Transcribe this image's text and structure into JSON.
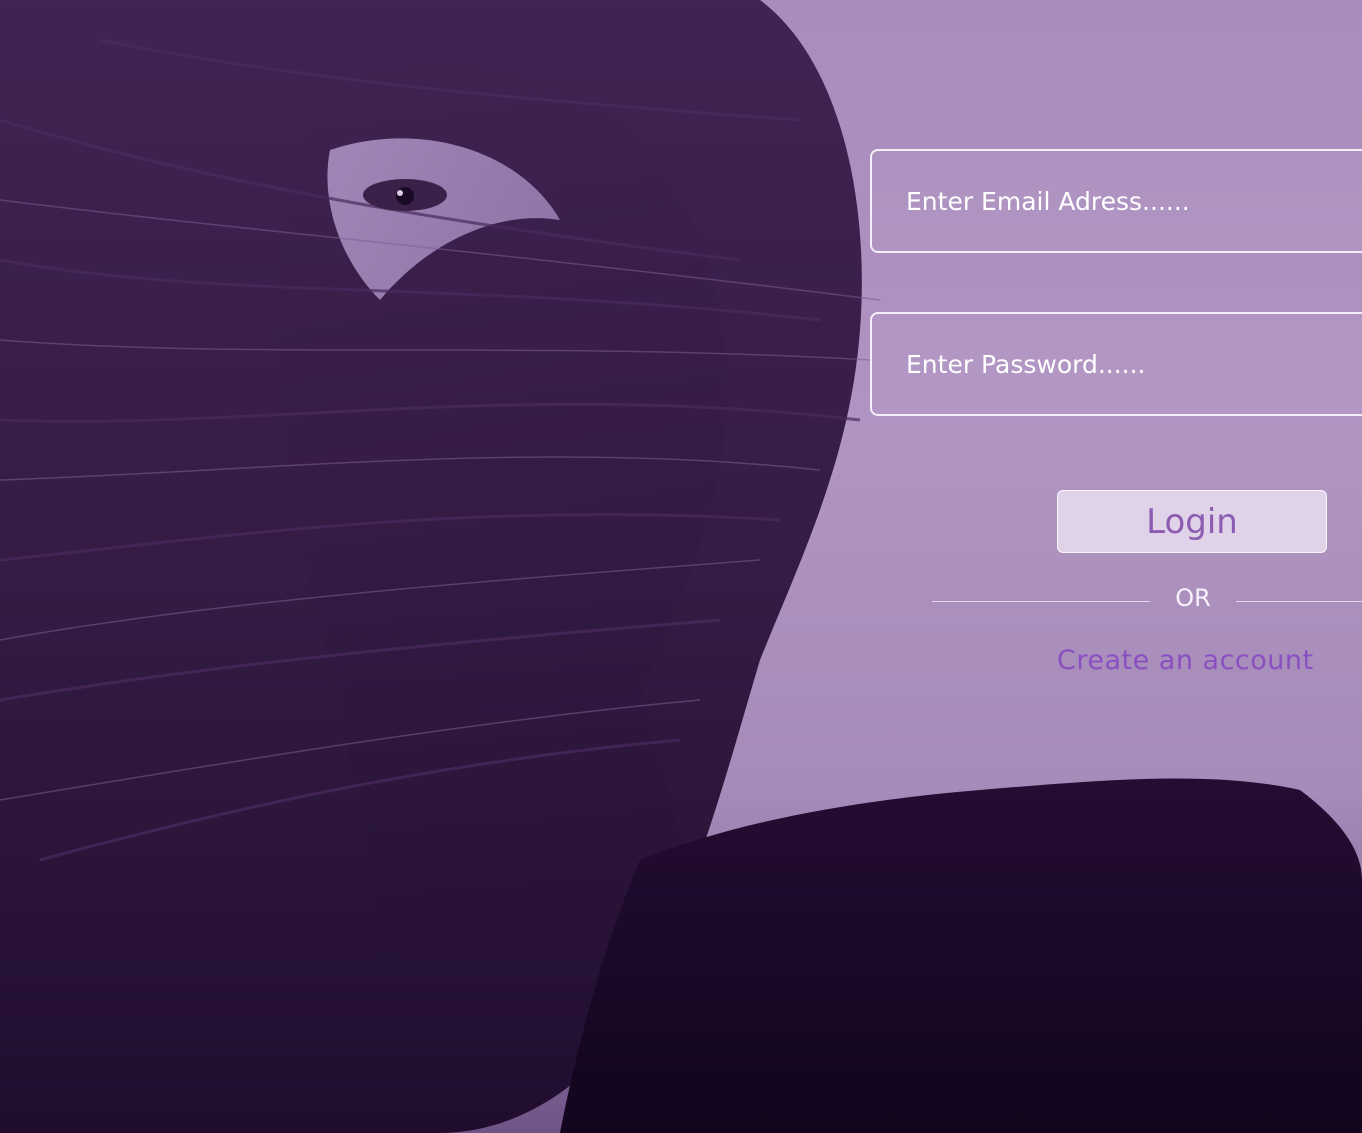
{
  "login_form": {
    "email_placeholder": "Enter Email Adress......",
    "password_placeholder": "Enter Password......",
    "login_label": "Login",
    "or_label": "OR",
    "create_account_label": "Create an account"
  },
  "colors": {
    "background": "#a98bbd",
    "photo_shadow": "#2a1238",
    "accent": "#8a4fc0",
    "field_border": "#f3eef7"
  }
}
